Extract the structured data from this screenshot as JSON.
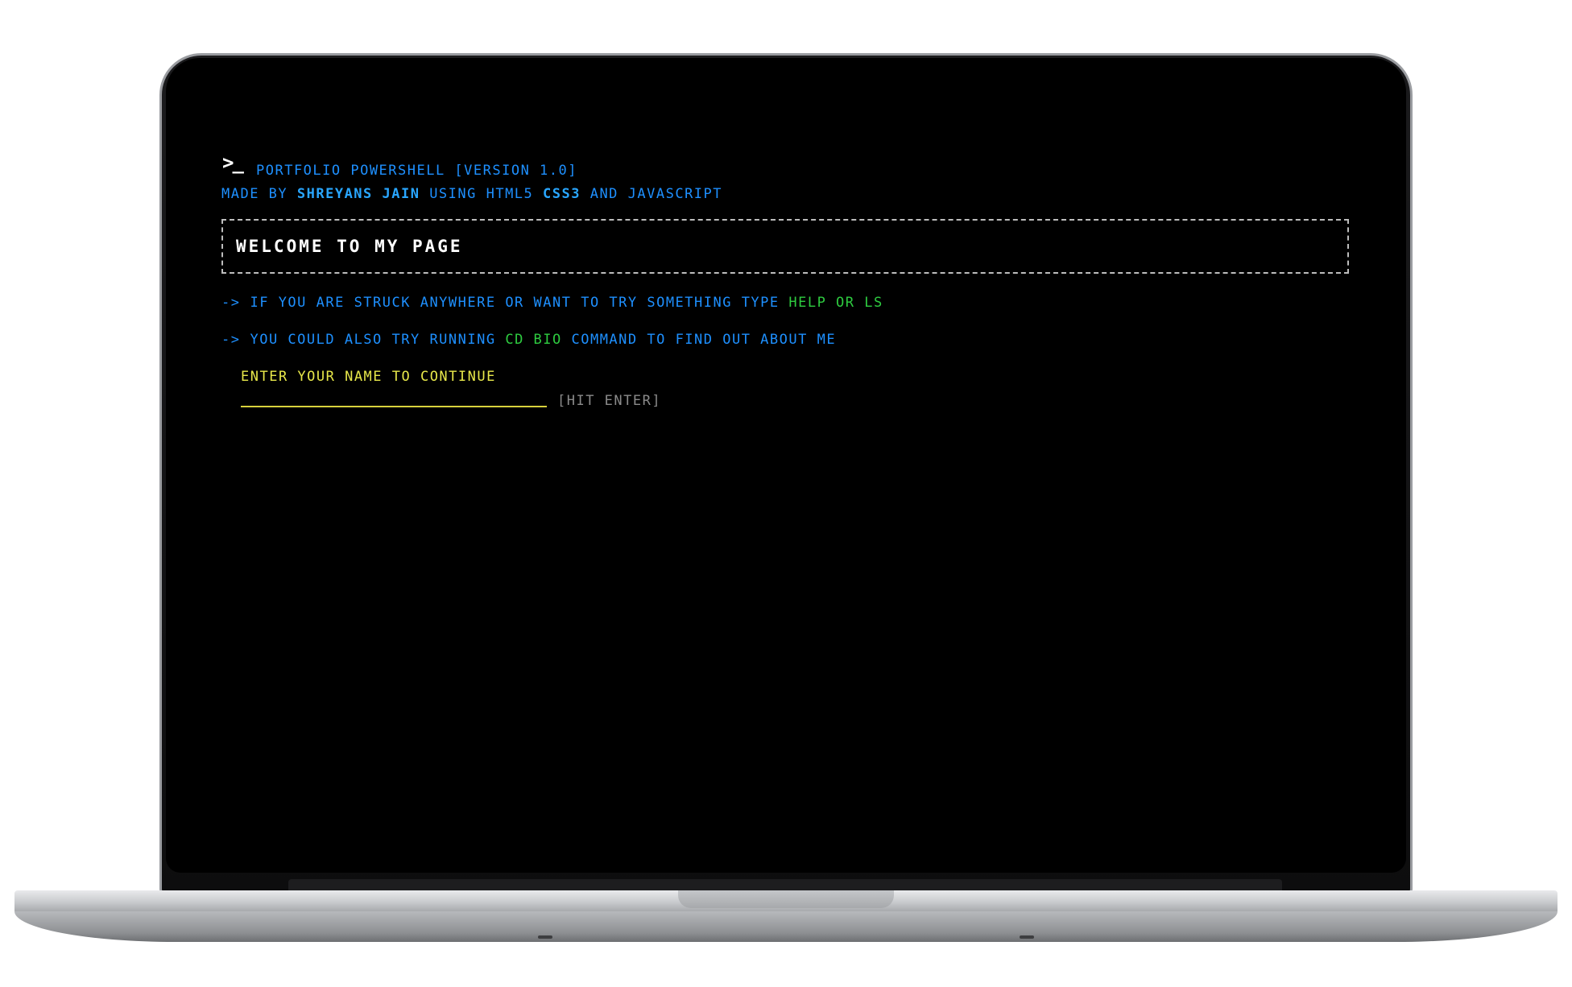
{
  "terminal": {
    "prompt_symbol": ">_",
    "title": "PORTFOLIO POWERSHELL [VERSION 1.0]",
    "made_by": {
      "prefix": "MADE BY ",
      "author": "SHREYANS JAIN",
      "using": " USING HTML5 ",
      "css": "CSS3",
      "and": " AND ",
      "js": "JAVASCRIPT"
    },
    "welcome": "WELCOME TO MY PAGE",
    "hints": [
      {
        "arrow": "->",
        "text": "IF YOU ARE STRUCK ANYWHERE OR WANT TO TRY SOMETHING TYPE ",
        "cmd": "HELP OR LS",
        "after": ""
      },
      {
        "arrow": "->",
        "text": "YOU COULD ALSO TRY RUNNING ",
        "cmd": "CD BIO",
        "after": " COMMAND TO FIND OUT ABOUT ME"
      }
    ],
    "enter_label": "ENTER YOUR NAME TO CONTINUE",
    "name_value": "",
    "hit_enter": "[HIT ENTER]"
  },
  "colors": {
    "background": "#000000",
    "primary_text": "#1e90ff",
    "command": "#2ecc40",
    "input": "#e8e84a",
    "muted": "#8a8a8a",
    "welcome": "#ffffff"
  }
}
